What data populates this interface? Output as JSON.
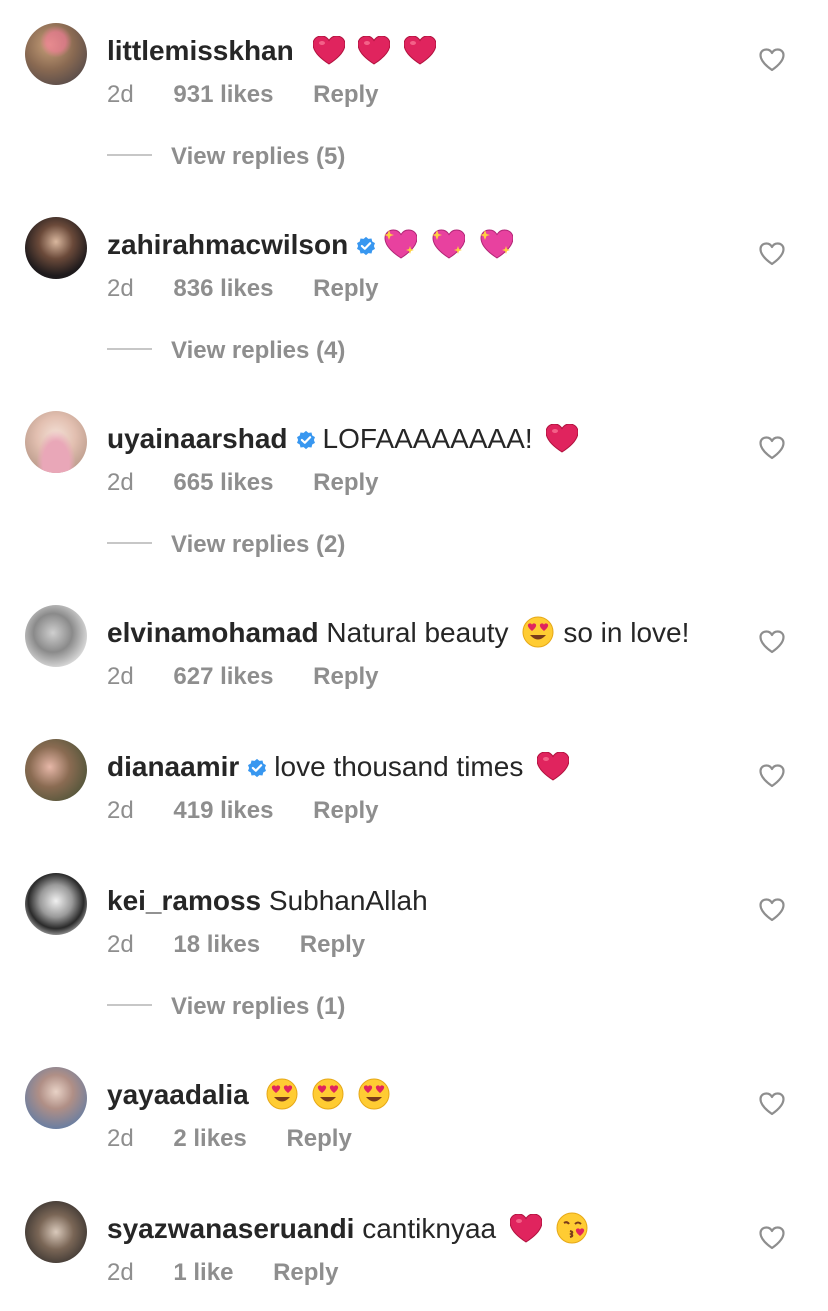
{
  "comments": [
    {
      "username": "littlemisskhan",
      "verified": false,
      "text": "",
      "emojis": [
        "red-heart",
        "red-heart",
        "red-heart"
      ],
      "time": "2d",
      "likes": "931 likes",
      "reply": "Reply",
      "view_replies": "View replies (5)"
    },
    {
      "username": "zahirahmacwilson",
      "verified": true,
      "text": "",
      "emojis": [
        "sparkling-heart",
        "sparkling-heart",
        "sparkling-heart"
      ],
      "time": "2d",
      "likes": "836 likes",
      "reply": "Reply",
      "view_replies": "View replies (4)"
    },
    {
      "username": "uyainaarshad",
      "verified": true,
      "text": "LOFAAAAAAAA!",
      "emojis": [
        "red-heart"
      ],
      "time": "2d",
      "likes": "665 likes",
      "reply": "Reply",
      "view_replies": "View replies (2)"
    },
    {
      "username": "elvinamohamad",
      "verified": false,
      "text": "Natural beauty",
      "emojis": [
        "heart-eyes"
      ],
      "text_after": "so in love!",
      "time": "2d",
      "likes": "627 likes",
      "reply": "Reply"
    },
    {
      "username": "dianaamir",
      "verified": true,
      "text": "love thousand times",
      "emojis": [
        "red-heart"
      ],
      "time": "2d",
      "likes": "419 likes",
      "reply": "Reply"
    },
    {
      "username": "kei_ramoss",
      "verified": false,
      "text": "SubhanAllah",
      "emojis": [],
      "time": "2d",
      "likes": "18 likes",
      "reply": "Reply",
      "view_replies": "View replies (1)"
    },
    {
      "username": "yayaadalia",
      "verified": false,
      "text": "",
      "emojis": [
        "heart-eyes",
        "heart-eyes",
        "heart-eyes"
      ],
      "time": "2d",
      "likes": "2 likes",
      "reply": "Reply"
    },
    {
      "username": "syazwanaseruandi",
      "verified": false,
      "text": "cantiknyaa",
      "emojis": [
        "red-heart",
        "kiss-face"
      ],
      "time": "2d",
      "likes": "1 like",
      "reply": "Reply"
    }
  ],
  "colors": {
    "text": "#262626",
    "secondary": "#8e8e8e",
    "verified": "#3897f0",
    "heart": "#e0245e"
  }
}
